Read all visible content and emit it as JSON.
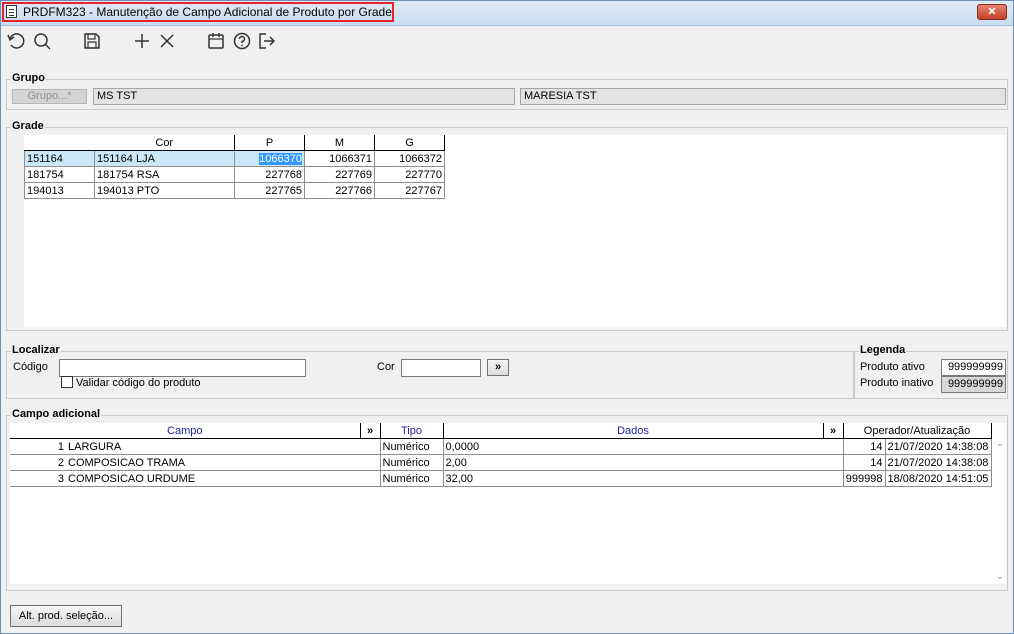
{
  "window": {
    "title": "PRDFM323 - Manutenção de Campo Adicional de Produto por Grade",
    "close": "x"
  },
  "toolbar": {
    "icons": [
      "refresh-icon",
      "search-icon",
      "save-icon",
      "add-icon",
      "delete-icon",
      "calendar-icon",
      "help-icon",
      "exit-icon"
    ]
  },
  "grupo": {
    "label": "Grupo",
    "button": "Grupo...*",
    "code": "MS TST",
    "name": "MARESIA TST"
  },
  "grade": {
    "label": "Grade",
    "headers": [
      "",
      "Cor",
      "P",
      "M",
      "G"
    ],
    "rows": [
      {
        "code": "151164",
        "cor": "151164 LJA",
        "p": "1066370",
        "m": "1066371",
        "g": "1066372"
      },
      {
        "code": "181754",
        "cor": "181754 RSA",
        "p": "227768",
        "m": "227769",
        "g": "227770"
      },
      {
        "code": "194013",
        "cor": "194013 PTO",
        "p": "227765",
        "m": "227766",
        "g": "227767"
      }
    ]
  },
  "localizar": {
    "label": "Localizar",
    "codigo_label": "Código",
    "codigo_value": "",
    "cor_label": "Cor",
    "cor_value": "",
    "go": "»",
    "validar_label": "Validar código do produto",
    "validar_checked": false
  },
  "legenda": {
    "label": "Legenda",
    "ativo_label": "Produto ativo",
    "ativo_value": "999999999",
    "inativo_label": "Produto inativo",
    "inativo_value": "999999999"
  },
  "campo_adicional": {
    "label": "Campo adicional",
    "headers": {
      "campo": "Campo",
      "tipo": "Tipo",
      "dados": "Dados",
      "operador": "Operador/Atualização",
      "expand": "»"
    },
    "rows": [
      {
        "n": "1",
        "campo": "LARGURA",
        "tipo": "Numérico",
        "dados": "0,0000",
        "op": "14",
        "data": "21/07/2020 14:38:08"
      },
      {
        "n": "2",
        "campo": "COMPOSICAO TRAMA",
        "tipo": "Numérico",
        "dados": "2,00",
        "op": "14",
        "data": "21/07/2020 14:38:08"
      },
      {
        "n": "3",
        "campo": "COMPOSICAO URDUME",
        "tipo": "Numérico",
        "dados": "32,00",
        "op": "999998",
        "data": "18/08/2020 14:51:05"
      }
    ]
  },
  "footer": {
    "alt_button": "Alt. prod. seleção..."
  },
  "colors": {
    "selected_row": "#cce8f8",
    "selected_cell": "#3399ff",
    "header_blue": "#1f1fa0",
    "title_border": "#e0262b"
  }
}
